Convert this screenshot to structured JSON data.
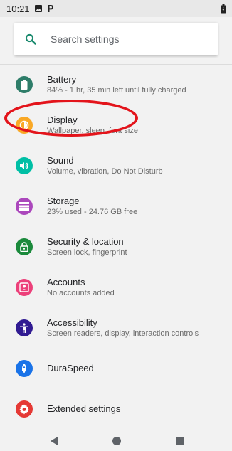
{
  "status_bar": {
    "time": "10:21",
    "icons": [
      "image-icon",
      "parking-icon",
      "battery-icon"
    ]
  },
  "search": {
    "placeholder": "Search settings",
    "icon": "search-icon",
    "icon_color": "#1a8a6e"
  },
  "settings": [
    {
      "id": "battery",
      "title": "Battery",
      "subtitle": "84% - 1 hr, 35 min left until fully charged",
      "icon": "battery-icon",
      "color": "#2e7d69"
    },
    {
      "id": "display",
      "title": "Display",
      "subtitle": "Wallpaper, sleep, font size",
      "icon": "brightness-icon",
      "color": "#f9a825"
    },
    {
      "id": "sound",
      "title": "Sound",
      "subtitle": "Volume, vibration, Do Not Disturb",
      "icon": "volume-icon",
      "color": "#00bfa5"
    },
    {
      "id": "storage",
      "title": "Storage",
      "subtitle": "23% used - 24.76 GB free",
      "icon": "storage-icon",
      "color": "#ab47bc"
    },
    {
      "id": "security",
      "title": "Security & location",
      "subtitle": "Screen lock, fingerprint",
      "icon": "lock-icon",
      "color": "#1b8a3c"
    },
    {
      "id": "accounts",
      "title": "Accounts",
      "subtitle": "No accounts added",
      "icon": "account-icon",
      "color": "#ec407a"
    },
    {
      "id": "accessibility",
      "title": "Accessibility",
      "subtitle": "Screen readers, display, interaction controls",
      "icon": "accessibility-icon",
      "color": "#311b92"
    },
    {
      "id": "duraspeed",
      "title": "DuraSpeed",
      "subtitle": "",
      "icon": "rocket-icon",
      "color": "#1a73e8"
    },
    {
      "id": "extended",
      "title": "Extended settings",
      "subtitle": "",
      "icon": "gear-icon",
      "color": "#e53935"
    }
  ],
  "annotation": {
    "target": "display",
    "color": "#e3141b"
  },
  "nav_bar": {
    "buttons": [
      "back-icon",
      "home-icon",
      "recents-icon"
    ]
  }
}
